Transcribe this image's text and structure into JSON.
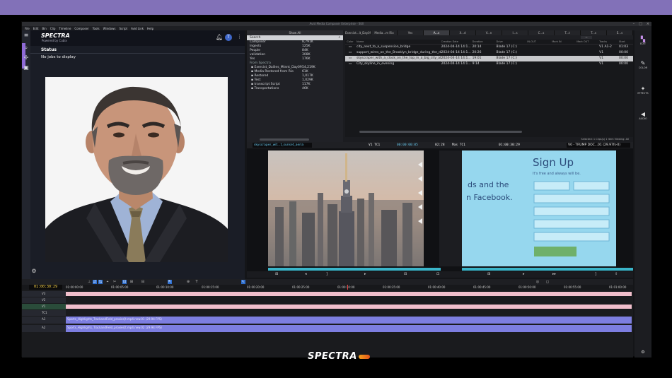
{
  "window": {
    "title": "Avid Media Composer Enterprise - Still",
    "menu": [
      "File",
      "Edit",
      "Bin",
      "Clip",
      "Timeline",
      "Composer",
      "Tools",
      "Windows",
      "Script",
      "Avid Link",
      "Help"
    ]
  },
  "spectra": {
    "logo": "SPECTRA",
    "tagline": "Powered by Cubix",
    "status_title": "Status",
    "status_message": "No jobs to display",
    "user_initial": "T"
  },
  "bin_list": {
    "header": "Show All",
    "search_placeholder": "Search",
    "rows": [
      {
        "name": "Composer",
        "value": "8,791K",
        "indent": false,
        "header": false
      },
      {
        "name": "Ingests",
        "value": "125K",
        "indent": false,
        "header": false
      },
      {
        "name": "People",
        "value": "84K",
        "indent": false,
        "header": false
      },
      {
        "name": "validation",
        "value": "308K",
        "indent": false,
        "header": false
      },
      {
        "name": "Yes",
        "value": "176K",
        "indent": false,
        "header": false
      },
      {
        "name": "From Spectra",
        "value": "",
        "indent": false,
        "header": true
      },
      {
        "name": "Exercist_Dailies_Mtnnt_Day09",
        "value": "54,219K",
        "indent": true,
        "header": false
      },
      {
        "name": "Media Restored from Rio",
        "value": "61K",
        "indent": true,
        "header": false
      },
      {
        "name": "Restored",
        "value": "1,017K",
        "indent": true,
        "header": false
      },
      {
        "name": "Test",
        "value": "1,029K",
        "indent": true,
        "header": false
      },
      {
        "name": "transcript Script",
        "value": "117K",
        "indent": true,
        "header": false
      },
      {
        "name": "Transportations",
        "value": "46K",
        "indent": true,
        "header": false
      }
    ]
  },
  "clip_tabs": [
    "Exercist...it_Day09",
    "Media...m Rio",
    "Yes",
    "A...s",
    "X...d",
    "V...n",
    "I...s",
    "C...s",
    "T...t",
    "T...s",
    "E...s"
  ],
  "clip_columns": [
    "Color",
    "Name",
    "Creation Date",
    "Duration",
    "Drive",
    "IN-OUT",
    "Mark IN",
    "Mark OUT",
    "Tracks",
    "Start"
  ],
  "clips": [
    {
      "name": "city_next_to_a_suspension_bridge",
      "date": "2024-04-14 14:1...",
      "duration": "20:14",
      "drive": "Blade 17 (C:)",
      "tracks": "V1 A1-2",
      "start": "01:03",
      "selected": false
    },
    {
      "name": "support_wires_on_the_Brooklyn_bridge_during_the_day",
      "date": "2024-04-14 14:1...",
      "duration": "20:26",
      "drive": "Blade 17 (C:)",
      "tracks": "V1",
      "start": "00:00",
      "selected": false
    },
    {
      "name": "skyscraper_with_a_clock_on_the_top_in_a_big_city_at_suns...",
      "date": "2024-04-14 14:1...",
      "duration": "19:01",
      "drive": "Blade 17 (C:)",
      "tracks": "V1",
      "start": "00:00",
      "selected": true
    },
    {
      "name": "City_skyline_in_evening",
      "date": "2024-04-14 14:1...",
      "duration": "9:14",
      "drive": "Blade 17 (C:)",
      "tracks": "V1",
      "start": "00:00",
      "selected": false
    }
  ],
  "clip_status": "Selected: 1 Clips(s) 1 item  Viewing: All",
  "monitors": {
    "source_clip": "skyscraper_wit...t_sunset_aeria",
    "source_tc_label": "V1 TC1",
    "source_tc": "00:00:00:05",
    "source_dur": "02:28",
    "record_tc_label": "Mas TC1",
    "record_tc": "01:00:30:29",
    "record_seq": "V0 - TRUMP DOC...01 (29.97fs-0)"
  },
  "timeline": {
    "timecode": "01:00:30:29",
    "ticks": [
      "01:00:00:00",
      "01:00:05:00",
      "01:00:10:00",
      "01:00:15:00",
      "01:00:20:00",
      "01:00:25:00",
      "01:00:30:00",
      "01:00:35:00",
      "01:00:40:00",
      "01:00:45:00",
      "01:00:50:00",
      "01:00:55:00",
      "01:01:00:00"
    ],
    "tracks": [
      "V3",
      "V2",
      "V1",
      "TC1",
      "A1",
      "A2"
    ],
    "audio_clip_1": "Sports_Highlights_TrackandField_proxies[t.mp4.new.01 (29.94 FPS)",
    "audio_clip_2": "Sports_Highlights_TrackandField_proxies[t.mp4.new.02 (29.94 FPS)"
  },
  "right_tools": [
    {
      "icon": "edit-icon",
      "label": "EDIT"
    },
    {
      "icon": "color-icon",
      "label": "COLOR"
    },
    {
      "icon": "effects-icon",
      "label": "EFFECTS"
    },
    {
      "icon": "audio-icon",
      "label": "AUDIO"
    }
  ],
  "footer_logo": "SPECTRA",
  "colors": {
    "frame_purple": "#8271b8",
    "accent_purple": "#8e6ad6",
    "selection": "#c7c8cb",
    "timecode_yellow": "#ffd84a",
    "source_cyan": "#67c6ea",
    "clip_pink": "#f1bfcc",
    "clip_purple": "#7d7ee0"
  }
}
